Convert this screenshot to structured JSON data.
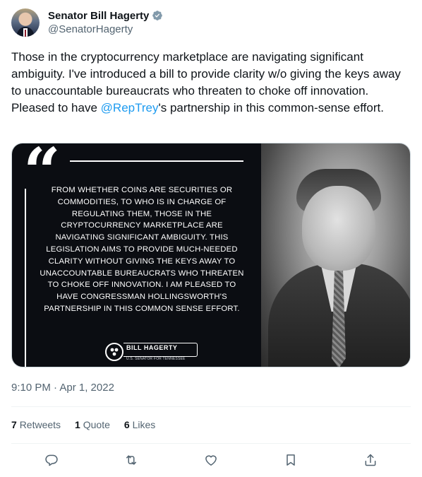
{
  "author": {
    "display_name": "Senator Bill Hagerty",
    "handle": "@SenatorHagerty"
  },
  "tweet": {
    "text_before": "Those in the cryptocurrency marketplace are navigating significant ambiguity. I've introduced a bill to provide clarity w/o giving the keys away to unaccountable bureaucrats who threaten to choke off innovation. Pleased to have ",
    "mention": "@RepTrey",
    "text_after": "'s partnership in this common-sense effort."
  },
  "media": {
    "quote_text": "From whether coins are securities or commodities, to who is in charge of regulating them, those in the cryptocurrency marketplace are navigating significant ambiguity. This legislation aims to provide much-needed clarity without giving the keys away to unaccountable bureaucrats who threaten to choke off innovation. I am pleased to have Congressman Hollingsworth's partnership in this common sense effort.",
    "logo_name": "BILL HAGERTY",
    "logo_subtitle": "U.S. SENATOR FOR TENNESSEE"
  },
  "timestamp": "9:10 PM · Apr 1, 2022",
  "stats": {
    "retweets_count": "7",
    "retweets_label": "Retweets",
    "quotes_count": "1",
    "quotes_label": "Quote",
    "likes_count": "6",
    "likes_label": "Likes"
  },
  "icons": {
    "verified": "verified-badge-icon",
    "reply": "reply-icon",
    "retweet": "retweet-icon",
    "like": "like-icon",
    "bookmark": "bookmark-icon",
    "share": "share-icon"
  },
  "colors": {
    "accent": "#1d9bf0",
    "secondary_text": "#536471"
  }
}
